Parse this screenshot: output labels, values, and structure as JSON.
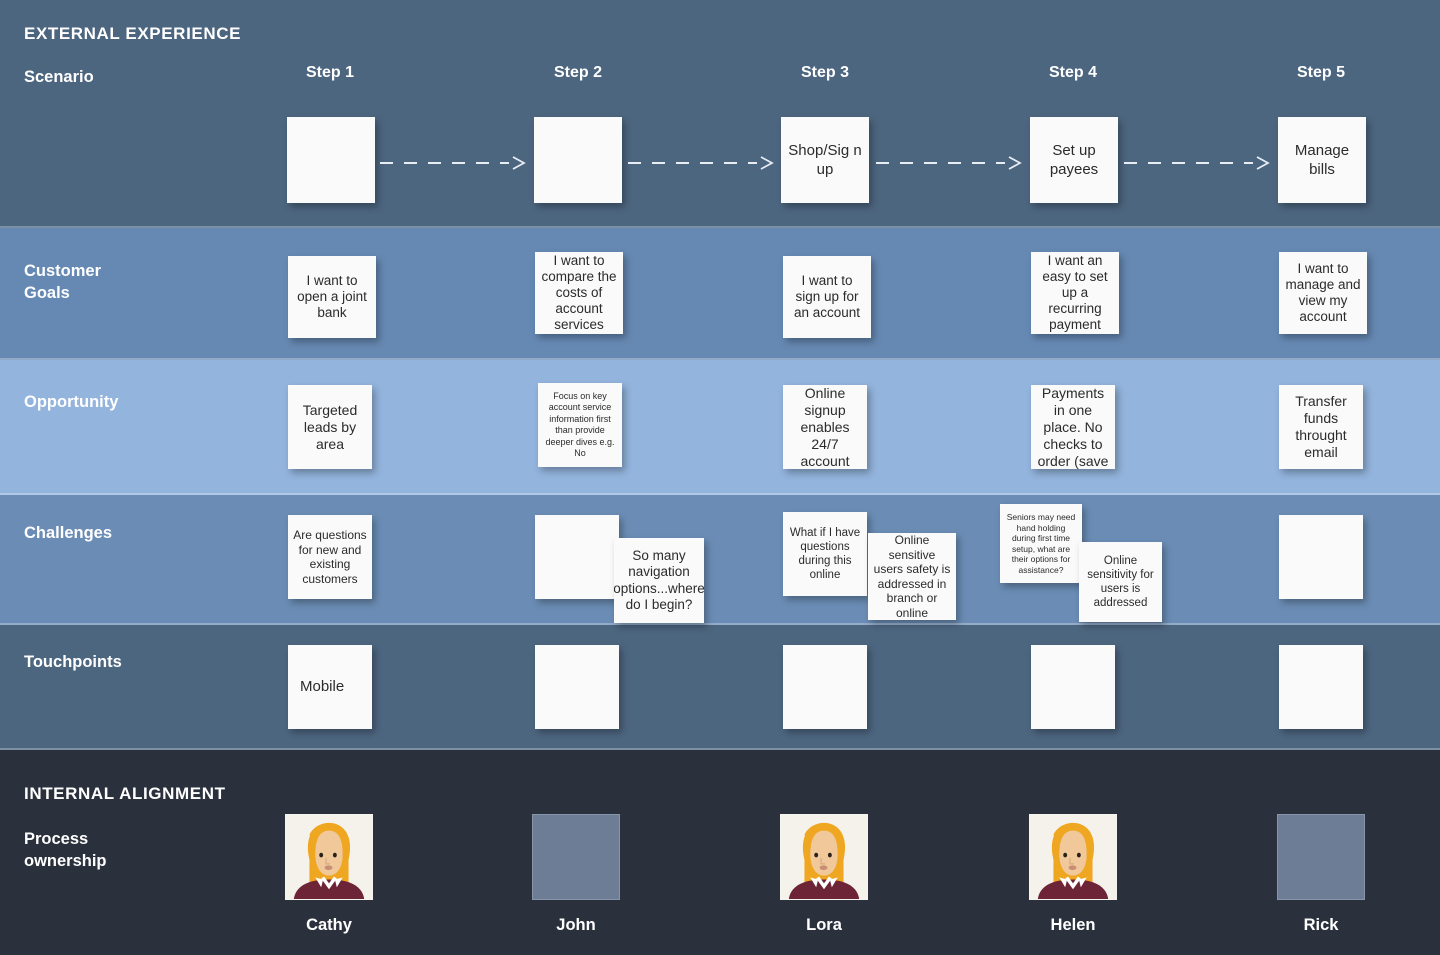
{
  "sections": {
    "external_title": "EXTERNAL EXPERIENCE",
    "internal_title": "INTERNAL ALIGNMENT"
  },
  "colors": {
    "header_band": "#4d6680",
    "goals_band": "#6689b3",
    "opportunity_band": "#93b4dd",
    "challenges_band": "#6b8db5",
    "touchpoints_band": "#4d6680",
    "internal_band": "#2b313c",
    "card": "#fafafa",
    "card_text": "#2b2b2b",
    "label_text": "#ffffff",
    "avatar_placeholder": "#6e7d96",
    "avatar_bg": "#f5f2ec",
    "avatar_hair": "#efa722",
    "avatar_skin": "#f0c89a",
    "avatar_shirt": "#6d2437"
  },
  "rows": {
    "scenario_label": "Scenario",
    "goals_label": "Customer\nGoals",
    "goals_label_line1": "Customer",
    "goals_label_line2": "Goals",
    "opportunity_label": "Opportunity",
    "challenges_label": "Challenges",
    "touchpoints_label": "Touchpoints",
    "process_label_line1": "Process",
    "process_label_line2": "ownership"
  },
  "steps": [
    {
      "header": "Step 1"
    },
    {
      "header": "Step 2"
    },
    {
      "header": "Step 3"
    },
    {
      "header": "Step 4"
    },
    {
      "header": "Step 5"
    }
  ],
  "scenario_cards": [
    {
      "text": ""
    },
    {
      "text": ""
    },
    {
      "text": "Shop/Sig n up"
    },
    {
      "text": "Set up payees"
    },
    {
      "text": "Manage bills"
    }
  ],
  "customer_goals": [
    {
      "text": "I want to open a joint bank"
    },
    {
      "text": "I want to compare the costs of account services"
    },
    {
      "text": "I want to sign up for an account"
    },
    {
      "text": "I want an easy to set up a recurring payment"
    },
    {
      "text": "I want to manage and view my account"
    }
  ],
  "opportunities": [
    {
      "text": "Targeted leads by area"
    },
    {
      "text": "Focus on key account service information first than provide deeper dives e.g. No"
    },
    {
      "text": "Online signup enables 24/7 account"
    },
    {
      "text": "Payments in one place. No checks to order (save"
    },
    {
      "text": "Transfer funds throught email"
    }
  ],
  "challenges": [
    {
      "primary": "Are questions for new and existing customers",
      "secondary": ""
    },
    {
      "primary": "",
      "secondary": "So many navigation options...where do I begin?"
    },
    {
      "primary": "What if I have questions during this online",
      "secondary": "Online sensitive users safety is addressed in branch or online"
    },
    {
      "primary": "Seniors may need hand holding during first time setup, what are their options for assistance?",
      "secondary": "Online sensitivity for users is addressed"
    },
    {
      "primary": "",
      "secondary": ""
    }
  ],
  "touchpoints": [
    {
      "text": "Mobile"
    },
    {
      "text": ""
    },
    {
      "text": ""
    },
    {
      "text": ""
    },
    {
      "text": ""
    }
  ],
  "process_ownership": [
    {
      "name": "Cathy",
      "avatar": "illustrated"
    },
    {
      "name": "John",
      "avatar": "placeholder"
    },
    {
      "name": "Lora",
      "avatar": "illustrated"
    },
    {
      "name": "Helen",
      "avatar": "illustrated"
    },
    {
      "name": "Rick",
      "avatar": "placeholder"
    }
  ],
  "connectors": [
    {
      "from": "Step 1",
      "to": "Step 2",
      "style": "dashed-arrow"
    },
    {
      "from": "Step 2",
      "to": "Step 3",
      "style": "dashed-arrow"
    },
    {
      "from": "Step 3",
      "to": "Step 4",
      "style": "dashed-arrow"
    },
    {
      "from": "Step 4",
      "to": "Step 5",
      "style": "dashed-arrow"
    }
  ]
}
